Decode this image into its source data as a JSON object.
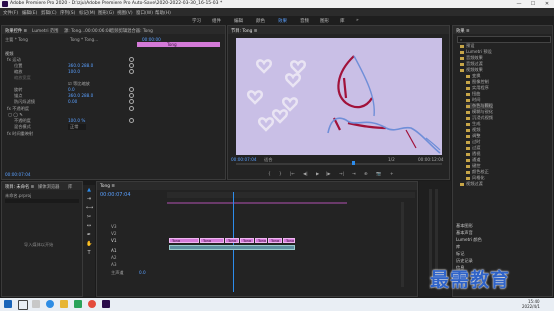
{
  "window": {
    "title": "Adobe Premiere Pro 2020 - D:\\zju\\Adobe Premiere Pro Auto-Save\\2020-2022-03-30_16-15-03 *",
    "minimize": "—",
    "maximize": "☐",
    "close": "✕"
  },
  "menu": [
    "文件(F)",
    "编辑(E)",
    "剪辑(C)",
    "序列(S)",
    "标记(M)",
    "图形(G)",
    "视图(V)",
    "窗口(W)",
    "帮助(H)"
  ],
  "workspaces": [
    "学习",
    "组件",
    "编辑",
    "颜色",
    "效果",
    "音频",
    "图形",
    "库",
    "»"
  ],
  "effect_controls": {
    "tabs": [
      "效果控件 ≡",
      "Lumetri 范围",
      "源: Tong...00:00:06:08",
      "音频剪辑混合器: Tong"
    ],
    "source_label": "主要 * Tong",
    "seq_label": "Tong * Tong...",
    "timecode": "00:00:00",
    "clip_label": "Tong",
    "rows": [
      {
        "label": "视频",
        "value": ""
      },
      {
        "label": "fx 运动",
        "value": ""
      },
      {
        "label": "位置",
        "value": "360.0   288.0"
      },
      {
        "label": "缩放",
        "value": "100.0"
      },
      {
        "label": "缩放宽度",
        "value": ""
      },
      {
        "label": "",
        "value": "☑ 等比缩放"
      },
      {
        "label": "旋转",
        "value": "0.0"
      },
      {
        "label": "锚点",
        "value": "360.0   288.0"
      },
      {
        "label": "防闪烁滤镜",
        "value": "0.00"
      },
      {
        "label": "fx 不透明度",
        "value": ""
      },
      {
        "label": "不透明度",
        "value": "100.0 %"
      },
      {
        "label": "混合模式",
        "value": "正常"
      },
      {
        "label": "fx 时间重映射",
        "value": ""
      }
    ],
    "footer_timecode": "00:00:07:04"
  },
  "program": {
    "tab": "节目: Tong ≡",
    "timecode_left": "00:00:07:04",
    "fit": "适合",
    "quality": "1/2",
    "timecode_right": "00:00:12:04",
    "transport": [
      "{",
      "}",
      "|←",
      "◀|",
      "▶",
      "|▶",
      "→|",
      "⇥",
      "⊕",
      "📷",
      "+"
    ]
  },
  "project": {
    "tabs": [
      "项目: 未命名 ≡",
      "媒体浏览器",
      "库"
    ],
    "file": "未命名.prproj",
    "empty_hint": "导入媒体以开始"
  },
  "timeline": {
    "tab": "Tong ≡",
    "timecode": "00:00:07:04",
    "tracks_v": [
      "V3",
      "V2",
      "V1"
    ],
    "tracks_a": [
      "A1",
      "A2",
      "A3"
    ],
    "master": "主声道",
    "master_val": "0.0",
    "clips": [
      "Tong",
      "Tong",
      "Tong",
      "Tong",
      "Tong",
      "Tong",
      "Tong"
    ]
  },
  "effects": {
    "tab": "效果 ≡",
    "search_placeholder": "",
    "items": [
      "预设",
      "Lumetri 预设",
      "音频效果",
      "音频过渡",
      "视频效果",
      "变换",
      "图像控制",
      "实用程序",
      "扭曲",
      "时间",
      "杂色与颗粒",
      "模糊与锐化",
      "沉浸式视频",
      "生成",
      "视频",
      "调整",
      "过时",
      "过渡",
      "透视",
      "通道",
      "键控",
      "颜色校正",
      "风格化",
      "视频过渡"
    ],
    "bottom": [
      "基本图形",
      "基本声音",
      "Lumetri 颜色",
      "库",
      "标记",
      "历史记录",
      "信息"
    ]
  },
  "taskbar": {
    "time": "15:40",
    "date": "2022/4/1"
  },
  "watermark": "最需教育",
  "colors": {
    "accent": "#2d8ceb",
    "clip": "#d47ad8",
    "preview_bg": "#c9bfe6",
    "wave": "#6f8ed8",
    "stroke": "#a1123a"
  }
}
